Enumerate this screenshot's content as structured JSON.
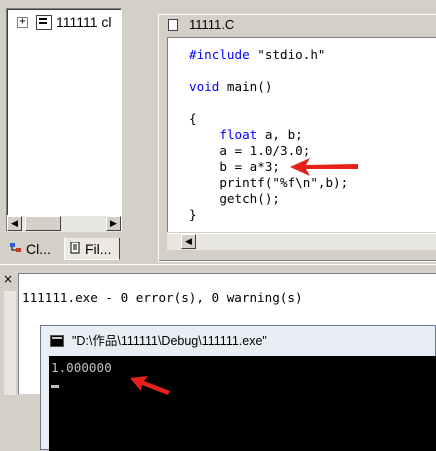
{
  "workspace": {
    "tree_item_label": "111111 cl",
    "expander_symbol": "+",
    "tabs": [
      {
        "label": "Cl...",
        "icon": "class-view-icon"
      },
      {
        "label": "Fil...",
        "icon": "file-view-icon"
      }
    ]
  },
  "editor": {
    "title": "11111.C",
    "code_lines": [
      {
        "kw": "#include",
        "rest": " \"stdio.h\""
      },
      {
        "kw": "",
        "rest": ""
      },
      {
        "kw": "void",
        "rest": " main()"
      },
      {
        "kw": "",
        "rest": ""
      },
      {
        "kw": "",
        "rest": "{"
      },
      {
        "kw": "    float",
        "rest": " a, b;"
      },
      {
        "kw": "",
        "rest": "    a = 1.0/3.0;"
      },
      {
        "kw": "",
        "rest": "    b = a*3;"
      },
      {
        "kw": "",
        "rest": "    printf(\"%f\\n\",b);"
      },
      {
        "kw": "",
        "rest": "    getch();"
      },
      {
        "kw": "",
        "rest": "}"
      }
    ]
  },
  "build_output": {
    "close_symbol": "×",
    "message": "111111.exe - 0 error(s), 0 warning(s)"
  },
  "console": {
    "title": "\"D:\\作品\\111111\\Debug\\111111.exe\"",
    "output": "1.000000"
  },
  "colors": {
    "keyword": "#0000ff",
    "annotation_arrow": "#e8201a",
    "console_bg": "#000000"
  }
}
